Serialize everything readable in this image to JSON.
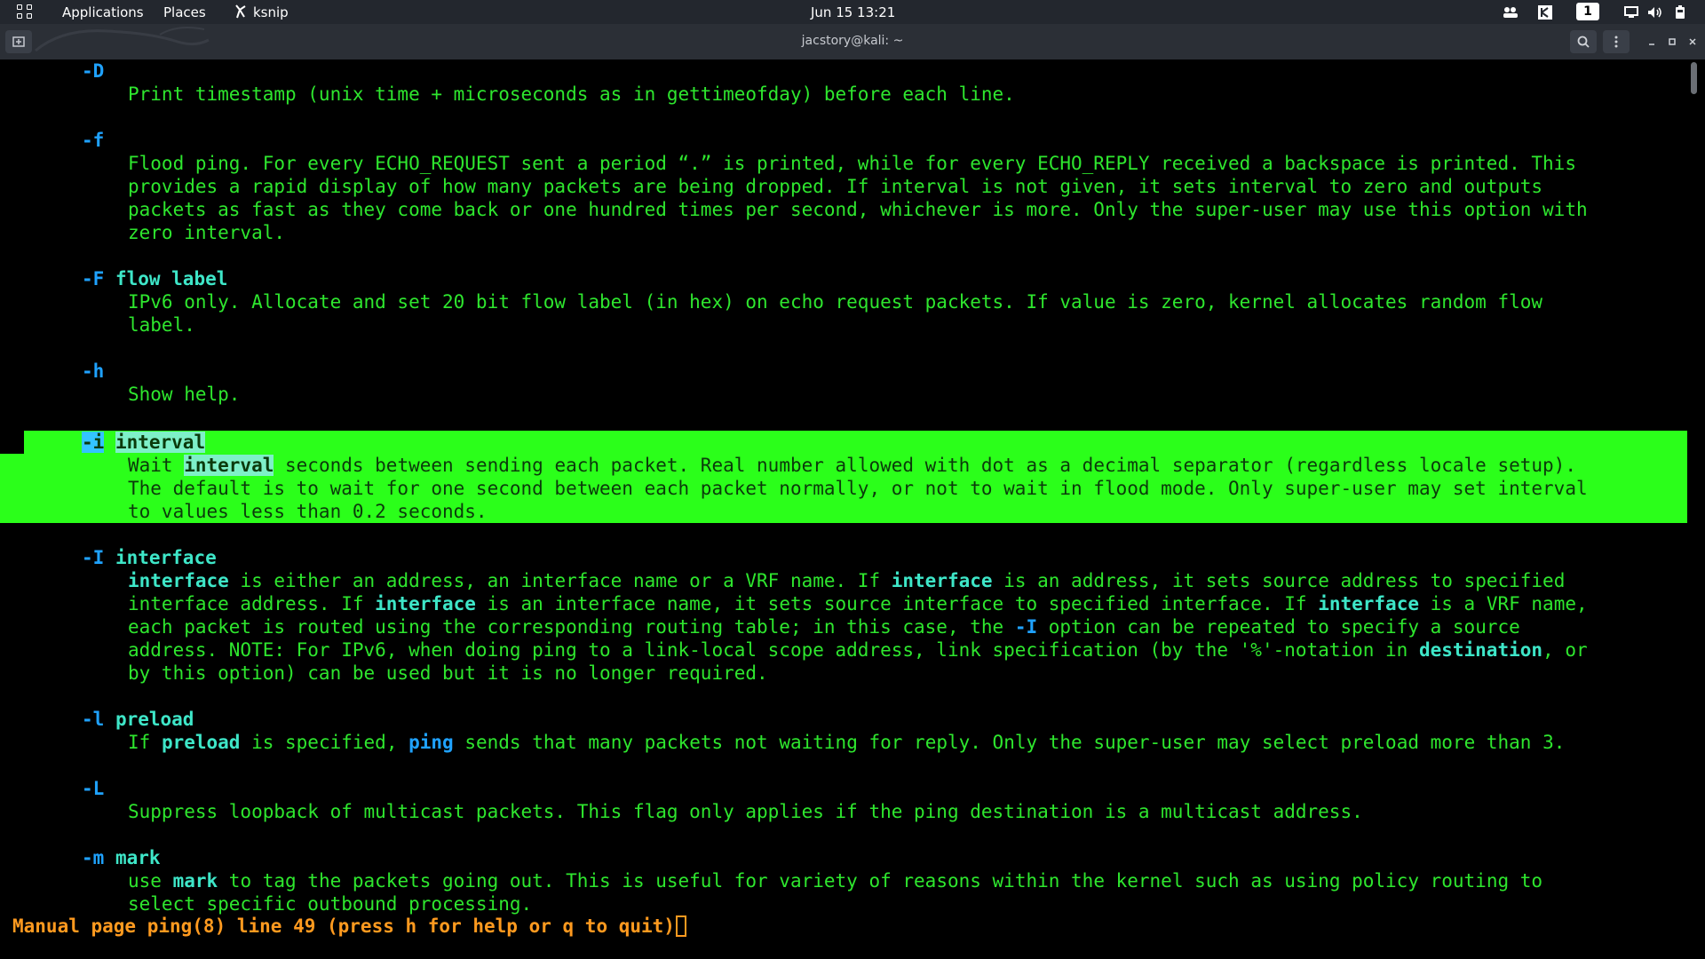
{
  "panel": {
    "applications": "Applications",
    "places": "Places",
    "app_name": "ksnip",
    "clock": "Jun 15  13:21",
    "workspace": "1",
    "tray_icons": [
      "people-icon",
      "ksnip-tray-icon",
      "workspace-badge",
      "display-icon",
      "volume-icon",
      "battery-icon"
    ]
  },
  "window": {
    "title": "jacstory@kali: ~",
    "buttons": [
      "new-tab-icon",
      "search-icon",
      "kebab-menu-icon",
      "minimize-icon",
      "maximize-icon",
      "close-icon"
    ]
  },
  "manpage": {
    "D": {
      "flag": "-D",
      "desc": "Print timestamp (unix time + microseconds as in gettimeofday) before each line."
    },
    "f": {
      "flag": "-f",
      "desc": [
        "Flood ping. For every ECHO_REQUEST sent a period “.” is printed, while for every ECHO_REPLY received a backspace is printed. This",
        "provides a rapid display of how many packets are being dropped. If interval is not given, it sets interval to zero and outputs",
        "packets as fast as they come back or one hundred times per second, whichever is more. Only the super-user may use this option with",
        "zero interval."
      ]
    },
    "F": {
      "flag": "-F",
      "arg": "flow label",
      "desc": [
        "IPv6 only. Allocate and set 20 bit flow label (in hex) on echo request packets. If value is zero, kernel allocates random flow",
        "label."
      ]
    },
    "h": {
      "flag": "-h",
      "desc": "Show help."
    },
    "i": {
      "flag": "-i",
      "arg": "interval",
      "line1_pre": "Wait ",
      "line1_bold": "interval",
      "line1_post": " seconds between sending each packet. Real number allowed with dot as a decimal separator (regardless locale setup).",
      "line2": "The default is to wait for one second between each packet normally, or not to wait in flood mode. Only super-user may set interval",
      "line3": "to values less than 0.2 seconds."
    },
    "I": {
      "flag": "-I",
      "arg": "interface",
      "l1a": "interface",
      "l1b": " is either an address, an interface name or a VRF name. If ",
      "l1c": "interface",
      "l1d": " is an address, it sets source address to specified",
      "l2a": "interface address. If ",
      "l2b": "interface",
      "l2c": " is an interface name, it sets source interface to specified interface. If ",
      "l2d": "interface",
      "l2e": " is a VRF name,",
      "l3a": "each packet is routed using the corresponding routing table; in this case, the ",
      "l3b": "-I",
      "l3c": " option can be repeated to specify a source",
      "l4a": "address. NOTE: For IPv6, when doing ping to a link-local scope address, link specification (by the '%'-notation in ",
      "l4b": "destination",
      "l4c": ", or",
      "l5": "by this option) can be used but it is no longer required."
    },
    "l": {
      "flag": "-l",
      "arg": "preload",
      "a": "If ",
      "b": "preload",
      "c": " is specified, ",
      "d": "ping",
      "e": " sends that many packets not waiting for reply. Only the super-user may select preload more than 3."
    },
    "L": {
      "flag": "-L",
      "desc": "Suppress loopback of multicast packets. This flag only applies if the ping destination is a multicast address."
    },
    "m": {
      "flag": "-m",
      "arg": "mark",
      "a": "use ",
      "b": "mark",
      "c": " to tag the packets going out. This is useful for variety of reasons within the kernel such as using policy routing to",
      "line2": "select specific outbound processing."
    }
  },
  "status_line": "Manual page ping(8) line 49 (press h for help or q to quit)"
}
